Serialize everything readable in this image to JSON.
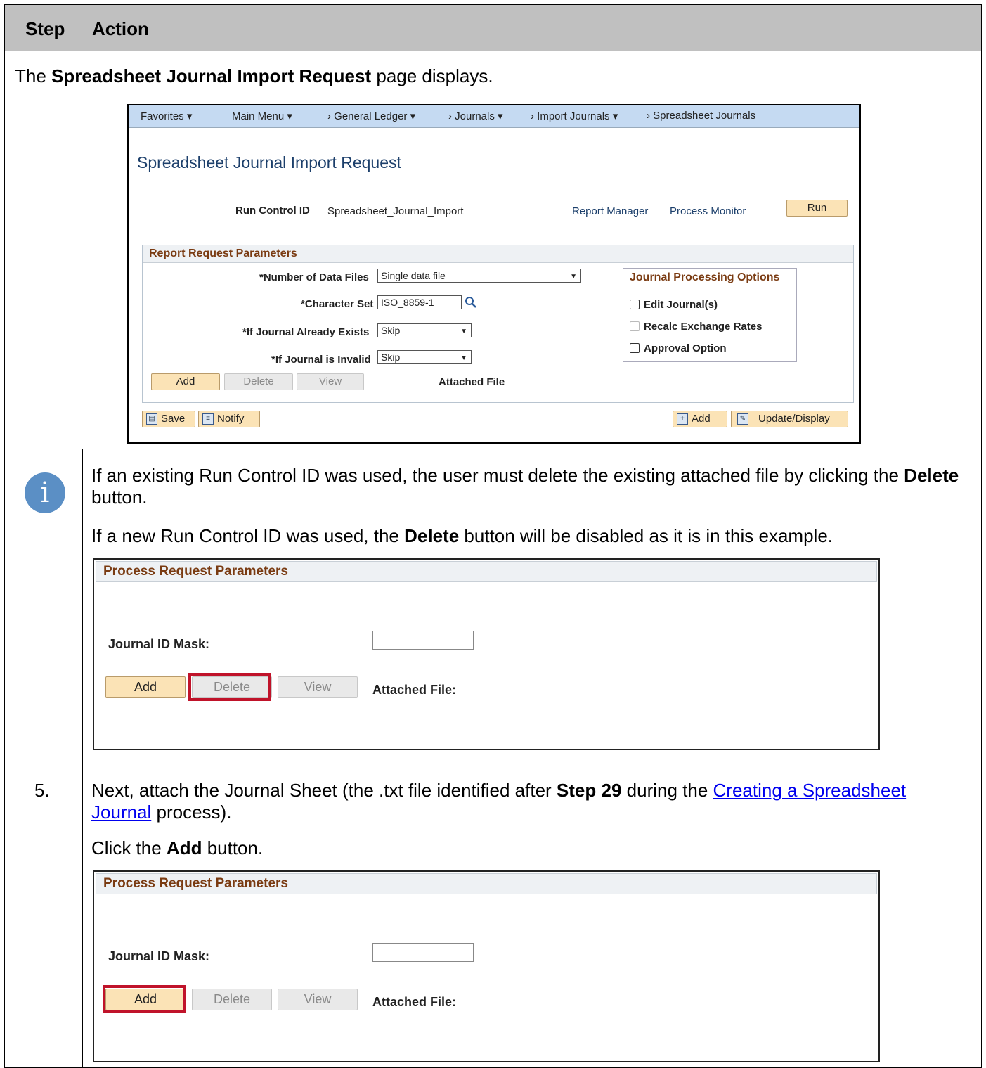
{
  "header": {
    "step": "Step",
    "action": "Action"
  },
  "row1": {
    "intro_pre": "The ",
    "intro_bold": "Spreadsheet Journal Import Request",
    "intro_post": " page displays.",
    "screenshot": {
      "nav": {
        "favorites": "Favorites ▾",
        "main_menu": "Main Menu ▾",
        "crumb1": "› General Ledger ▾",
        "crumb2": "› Journals ▾",
        "crumb3": "› Import Journals ▾",
        "crumb4": "› Spreadsheet Journals"
      },
      "title": "Spreadsheet Journal Import Request",
      "run_control_label": "Run Control ID",
      "run_control_value": "Spreadsheet_Journal_Import",
      "report_manager": "Report Manager",
      "process_monitor": "Process Monitor",
      "run_button": "Run",
      "group_title": "Report Request Parameters",
      "num_files_label": "*Number of Data Files",
      "num_files_value": "Single data file",
      "charset_label": "*Character Set",
      "charset_value": "ISO_8859-1",
      "exists_label": "*If Journal Already Exists",
      "exists_value": "Skip",
      "invalid_label": "*If Journal is Invalid",
      "invalid_value": "Skip",
      "add_button": "Add",
      "delete_button": "Delete",
      "view_button": "View",
      "attached_file_label": "Attached File",
      "options_title": "Journal Processing Options",
      "opt_edit": "Edit Journal(s)",
      "opt_recalc": "Recalc Exchange Rates",
      "opt_approval": "Approval Option",
      "save_button": "Save",
      "notify_button": "Notify",
      "add_bottom_button": "Add",
      "update_display_button": "Update/Display"
    }
  },
  "row2": {
    "p1_pre": "If an existing Run Control ID was used, the user must delete the existing attached file by clicking the ",
    "p1_bold": "Delete",
    "p1_post": " button.",
    "p2_pre": "If a new Run Control ID was used, the ",
    "p2_bold": "Delete",
    "p2_post": " button will be disabled as it is in this example.",
    "screenshot": {
      "title": "Process Request Parameters",
      "mask_label": "Journal ID Mask:",
      "add_button": "Add",
      "delete_button": "Delete",
      "view_button": "View",
      "attached_label": "Attached File:"
    }
  },
  "row3": {
    "step_number": "5.",
    "p1_pre": "Next, attach the Journal Sheet (the .txt file identified after ",
    "p1_bold": "Step 29",
    "p1_mid": " during the ",
    "p1_link": "Creating a Spreadsheet Journal",
    "p1_post": " process).",
    "p2_pre": "Click the ",
    "p2_bold": "Add",
    "p2_post": " button.",
    "screenshot": {
      "title": "Process Request Parameters",
      "mask_label": "Journal ID Mask:",
      "add_button": "Add",
      "delete_button": "Delete",
      "view_button": "View",
      "attached_label": "Attached File:"
    }
  },
  "colors": {
    "highlight": "#c0132a",
    "link": "#0000ee",
    "header_bg": "#c0c0c0"
  }
}
